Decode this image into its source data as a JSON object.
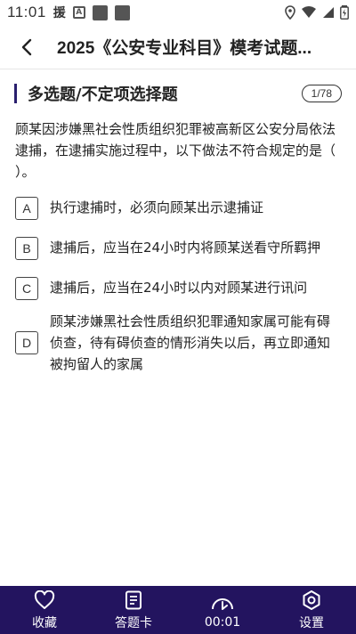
{
  "status_bar": {
    "time": "11:01",
    "left_glyph": "援",
    "small_icon_text": "A"
  },
  "header": {
    "back_icon": "chevron-left-icon",
    "title": "2025《公安专业科目》模考试题..."
  },
  "question": {
    "type_label": "多选题/不定项选择题",
    "progress": "1/78",
    "stem": "顾某因涉嫌黑社会性质组织犯罪被高新区公安分局依法逮捕，在逮捕实施过程中，以下做法不符合规定的是（ ）。",
    "options": [
      {
        "letter": "A",
        "text": "执行逮捕时，必须向顾某出示逮捕证"
      },
      {
        "letter": "B",
        "text": "逮捕后，应当在24小时内将顾某送看守所羁押"
      },
      {
        "letter": "C",
        "text": "逮捕后，应当在24小时以内对顾某进行讯问"
      },
      {
        "letter": "D",
        "text": "顾某涉嫌黑社会性质组织犯罪通知家属可能有碍侦查，待有碍侦查的情形消失以后，再立即通知被拘留人的家属"
      }
    ]
  },
  "bottom_bar": {
    "tabs": [
      {
        "label": "收藏",
        "icon": "heart-icon"
      },
      {
        "label": "答题卡",
        "icon": "answer-card-icon"
      },
      {
        "label": "00:01",
        "icon": "timer-icon"
      },
      {
        "label": "设置",
        "icon": "settings-icon"
      }
    ],
    "background_color": "#23145f"
  },
  "accent_color": "#2a1f6e"
}
